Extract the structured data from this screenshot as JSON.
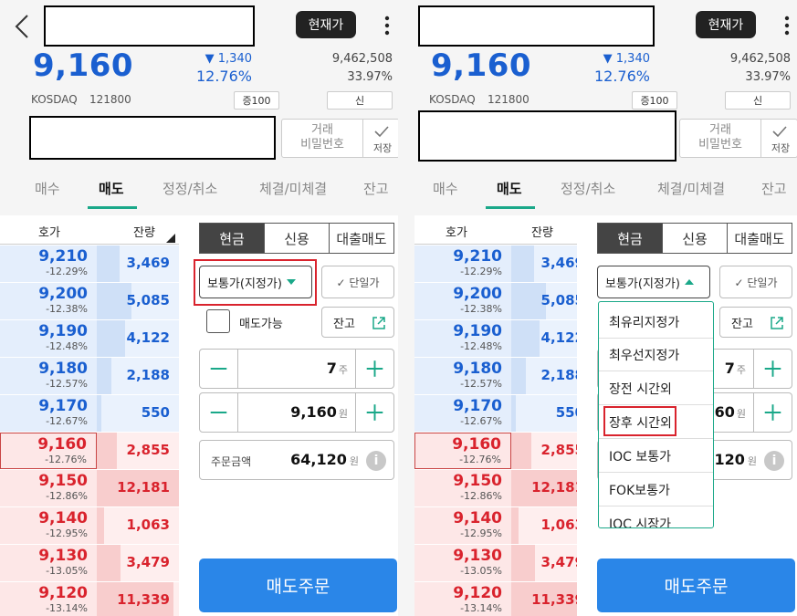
{
  "header": {
    "current_price_button": "현재가"
  },
  "quote": {
    "price": "9,160",
    "change": "▼ 1,340",
    "change_rate": "12.76%",
    "volume": "9,462,508",
    "volume_rate": "33.97%",
    "market": "KOSDAQ",
    "code": "121800",
    "margin_badge": "증100",
    "credit_badge": "신"
  },
  "password": {
    "label_line1": "거래",
    "label_line2": "비밀번호",
    "save_label": "저장"
  },
  "tabs": [
    "매수",
    "매도",
    "정정/취소",
    "체결/미체결",
    "잔고"
  ],
  "active_tab": "매도",
  "orderbook": {
    "header_price": "호가",
    "header_qty": "잔량",
    "rows": [
      {
        "price": "9,210",
        "rate": "-12.29%",
        "qty": "3,469",
        "side": "ask",
        "fill": 0.28
      },
      {
        "price": "9,200",
        "rate": "-12.38%",
        "qty": "5,085",
        "side": "ask",
        "fill": 0.42
      },
      {
        "price": "9,190",
        "rate": "-12.48%",
        "qty": "4,122",
        "side": "ask",
        "fill": 0.34
      },
      {
        "price": "9,180",
        "rate": "-12.57%",
        "qty": "2,188",
        "side": "ask",
        "fill": 0.18
      },
      {
        "price": "9,170",
        "rate": "-12.67%",
        "qty": "550",
        "side": "ask",
        "fill": 0.05
      },
      {
        "price": "9,160",
        "rate": "-12.76%",
        "qty": "2,855",
        "side": "bid",
        "fill": 0.24
      },
      {
        "price": "9,150",
        "rate": "-12.86%",
        "qty": "12,181",
        "side": "bid",
        "fill": 1.0
      },
      {
        "price": "9,140",
        "rate": "-12.95%",
        "qty": "1,063",
        "side": "bid",
        "fill": 0.09
      },
      {
        "price": "9,130",
        "rate": "-13.05%",
        "qty": "3,479",
        "side": "bid",
        "fill": 0.29
      },
      {
        "price": "9,120",
        "rate": "-13.14%",
        "qty": "11,339",
        "side": "bid",
        "fill": 0.93
      }
    ]
  },
  "order_form": {
    "segments": [
      "현금",
      "신용",
      "대출매도"
    ],
    "order_type": "보통가(지정가)",
    "unit_price_label": "✓ 단일가",
    "sellable_label": "매도가능",
    "balance_label": "잔고",
    "quantity": "7",
    "quantity_unit": "주",
    "price": "9,160",
    "price_unit": "원",
    "amount_label": "주문금액",
    "amount": "64,120",
    "amount_unit": "원",
    "info_label": "i",
    "submit": "매도주문"
  },
  "dropdown": {
    "items": [
      "최유리지정가",
      "최우선지정가",
      "장전 시간외",
      "장후 시간외",
      "IOC 보통가",
      "FOK보통가",
      "IOC 시장가"
    ],
    "highlighted": "장후 시간외"
  },
  "colors": {
    "down_blue": "#1a5fd0",
    "up_red": "#d9232d",
    "accent_green": "#1aa889",
    "order_button": "#2a86e8",
    "highlight_box": "#d9232d"
  }
}
